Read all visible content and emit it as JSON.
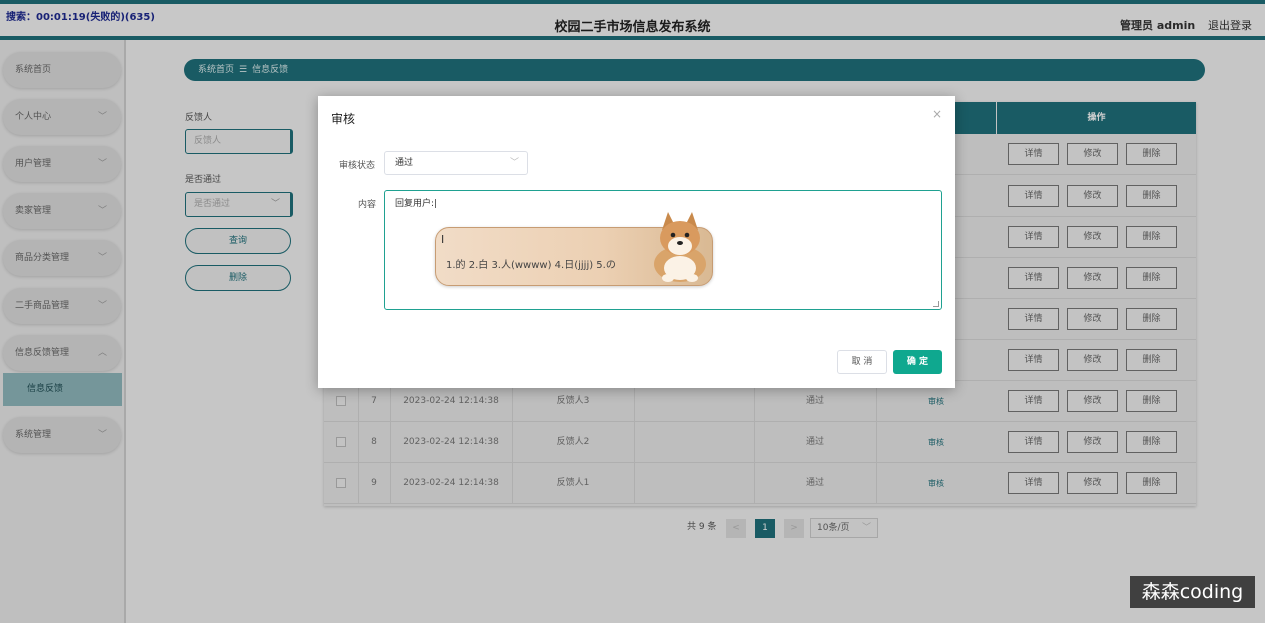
{
  "header": {
    "recording": "搜索：00:01:19(失败的)(635)",
    "title": "校园二手市场信息发布系统",
    "admin": "管理员 admin",
    "logout": "退出登录"
  },
  "sidebar": {
    "items": [
      {
        "label": "系统首页"
      },
      {
        "label": "个人中心"
      },
      {
        "label": "用户管理"
      },
      {
        "label": "卖家管理"
      },
      {
        "label": "商品分类管理"
      },
      {
        "label": "二手商品管理"
      },
      {
        "label": "信息反馈管理"
      },
      {
        "label": "系统管理"
      }
    ],
    "sub_active": "信息反馈",
    "chevron_down": "﹀",
    "chevron_up": "︿"
  },
  "breadcrumb": {
    "home": "系统首页",
    "separator": "☰",
    "current": "信息反馈"
  },
  "search": {
    "feedback_label": "反馈人",
    "feedback_placeholder": "反馈人",
    "passed_label": "是否通过",
    "passed_placeholder": "是否通过",
    "query_button": "查询",
    "delete_button": "删除"
  },
  "table": {
    "op_header": "操作",
    "op_buttons": [
      "详情",
      "修改",
      "删除"
    ],
    "rows": [
      {
        "index": "7",
        "time": "2023-02-24 12:14:38",
        "name": "反馈人3",
        "status": "通过",
        "audit": "审核"
      },
      {
        "index": "8",
        "time": "2023-02-24 12:14:38",
        "name": "反馈人2",
        "status": "通过",
        "audit": "审核"
      },
      {
        "index": "9",
        "time": "2023-02-24 12:14:38",
        "name": "反馈人1",
        "status": "通过",
        "audit": "审核"
      }
    ]
  },
  "pagination": {
    "total": "共 9 条",
    "prev": "<",
    "current": "1",
    "next": ">",
    "page_size": "10条/页"
  },
  "dialog": {
    "title": "审核",
    "close": "×",
    "status_label": "审核状态",
    "status_value": "通过",
    "content_label": "内容",
    "content_value": "回复用户:|",
    "emoji_candidates": "1.的  2.白  3.人(wwww)  4.日(jjjj)  5.の",
    "cursor": "I",
    "cancel": "取 消",
    "confirm": "确 定"
  },
  "watermark": "森森coding",
  "colors": {
    "primary": "#1f6f7a",
    "confirm": "#0fa88f"
  }
}
